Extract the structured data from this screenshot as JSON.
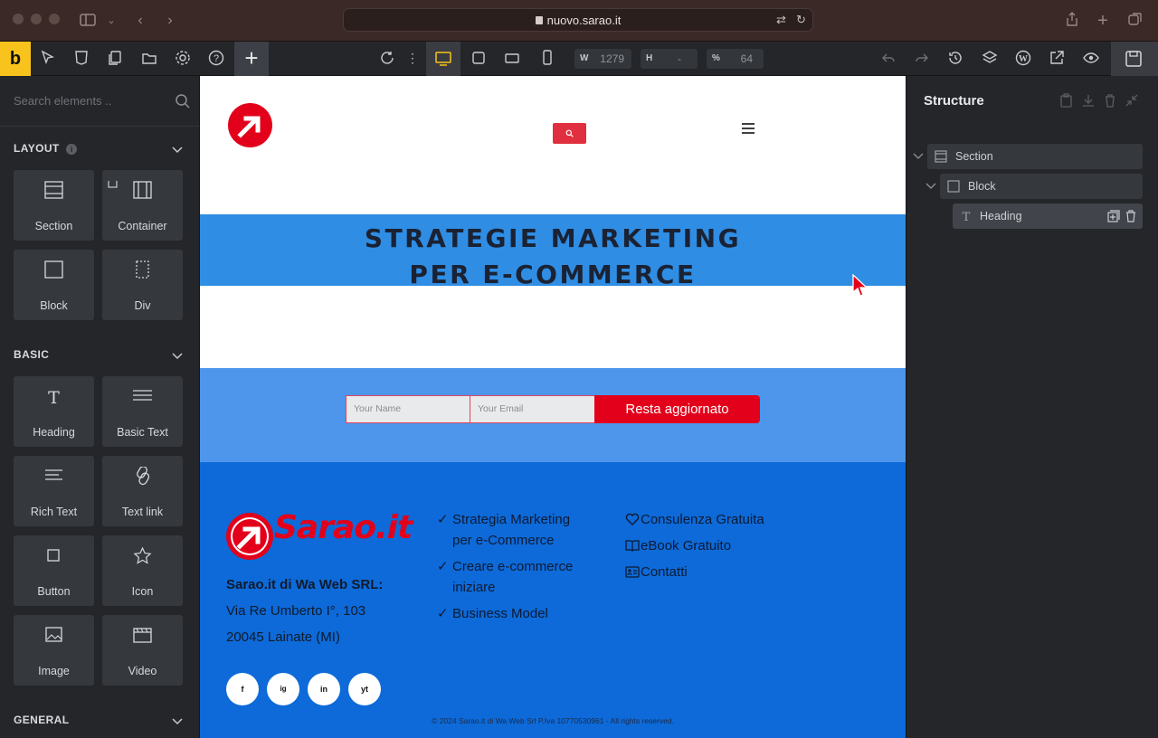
{
  "browser": {
    "url": "nuovo.sarao.it"
  },
  "toolbar": {
    "logo_letter": "b",
    "width_label": "W",
    "width_value": "1279",
    "height_label": "H",
    "height_value": "-",
    "zoom_label": "%",
    "zoom_value": "64"
  },
  "left_panel": {
    "search_placeholder": "Search elements ..",
    "sections": [
      {
        "title": "LAYOUT",
        "items": [
          "Section",
          "Container",
          "Block",
          "Div"
        ]
      },
      {
        "title": "BASIC",
        "items": [
          "Heading",
          "Basic Text",
          "Rich Text",
          "Text link",
          "Button",
          "Icon",
          "Image",
          "Video"
        ]
      },
      {
        "title": "GENERAL"
      }
    ]
  },
  "canvas": {
    "hero_line1": "STRATEGIE MARKETING",
    "hero_line2": "PER E-COMMERCE",
    "newsletter": {
      "name_placeholder": "Your Name",
      "email_placeholder": "Your Email",
      "button": "Resta aggiornato"
    },
    "footer": {
      "brand": "Sarao.it",
      "company": "Sarao.it di Wa Web SRL:",
      "address1": "Via Re Umberto I°, 103",
      "address2": "20045 Lainate (MI)",
      "col2": [
        "Strategia Marketing",
        "per e-Commerce",
        "Creare e-commerce",
        "iniziare",
        "Business Model"
      ],
      "col3": [
        "Consulenza Gratuita",
        "eBook Gratuito",
        "Contatti"
      ],
      "social": [
        "f",
        "ig",
        "in",
        "yt"
      ],
      "copyright": "© 2024 Sarao.it di Wa Web Srl P.Iva 10770530961 - All rights reserved."
    }
  },
  "right_panel": {
    "title": "Structure",
    "tree": [
      "Section",
      "Block",
      "Heading"
    ]
  },
  "colors": {
    "brand_red": "#e3001a",
    "hero_blue": "#2f8de4",
    "footer_blue": "#0d6ad8",
    "accent_yellow": "#f7c31c"
  }
}
